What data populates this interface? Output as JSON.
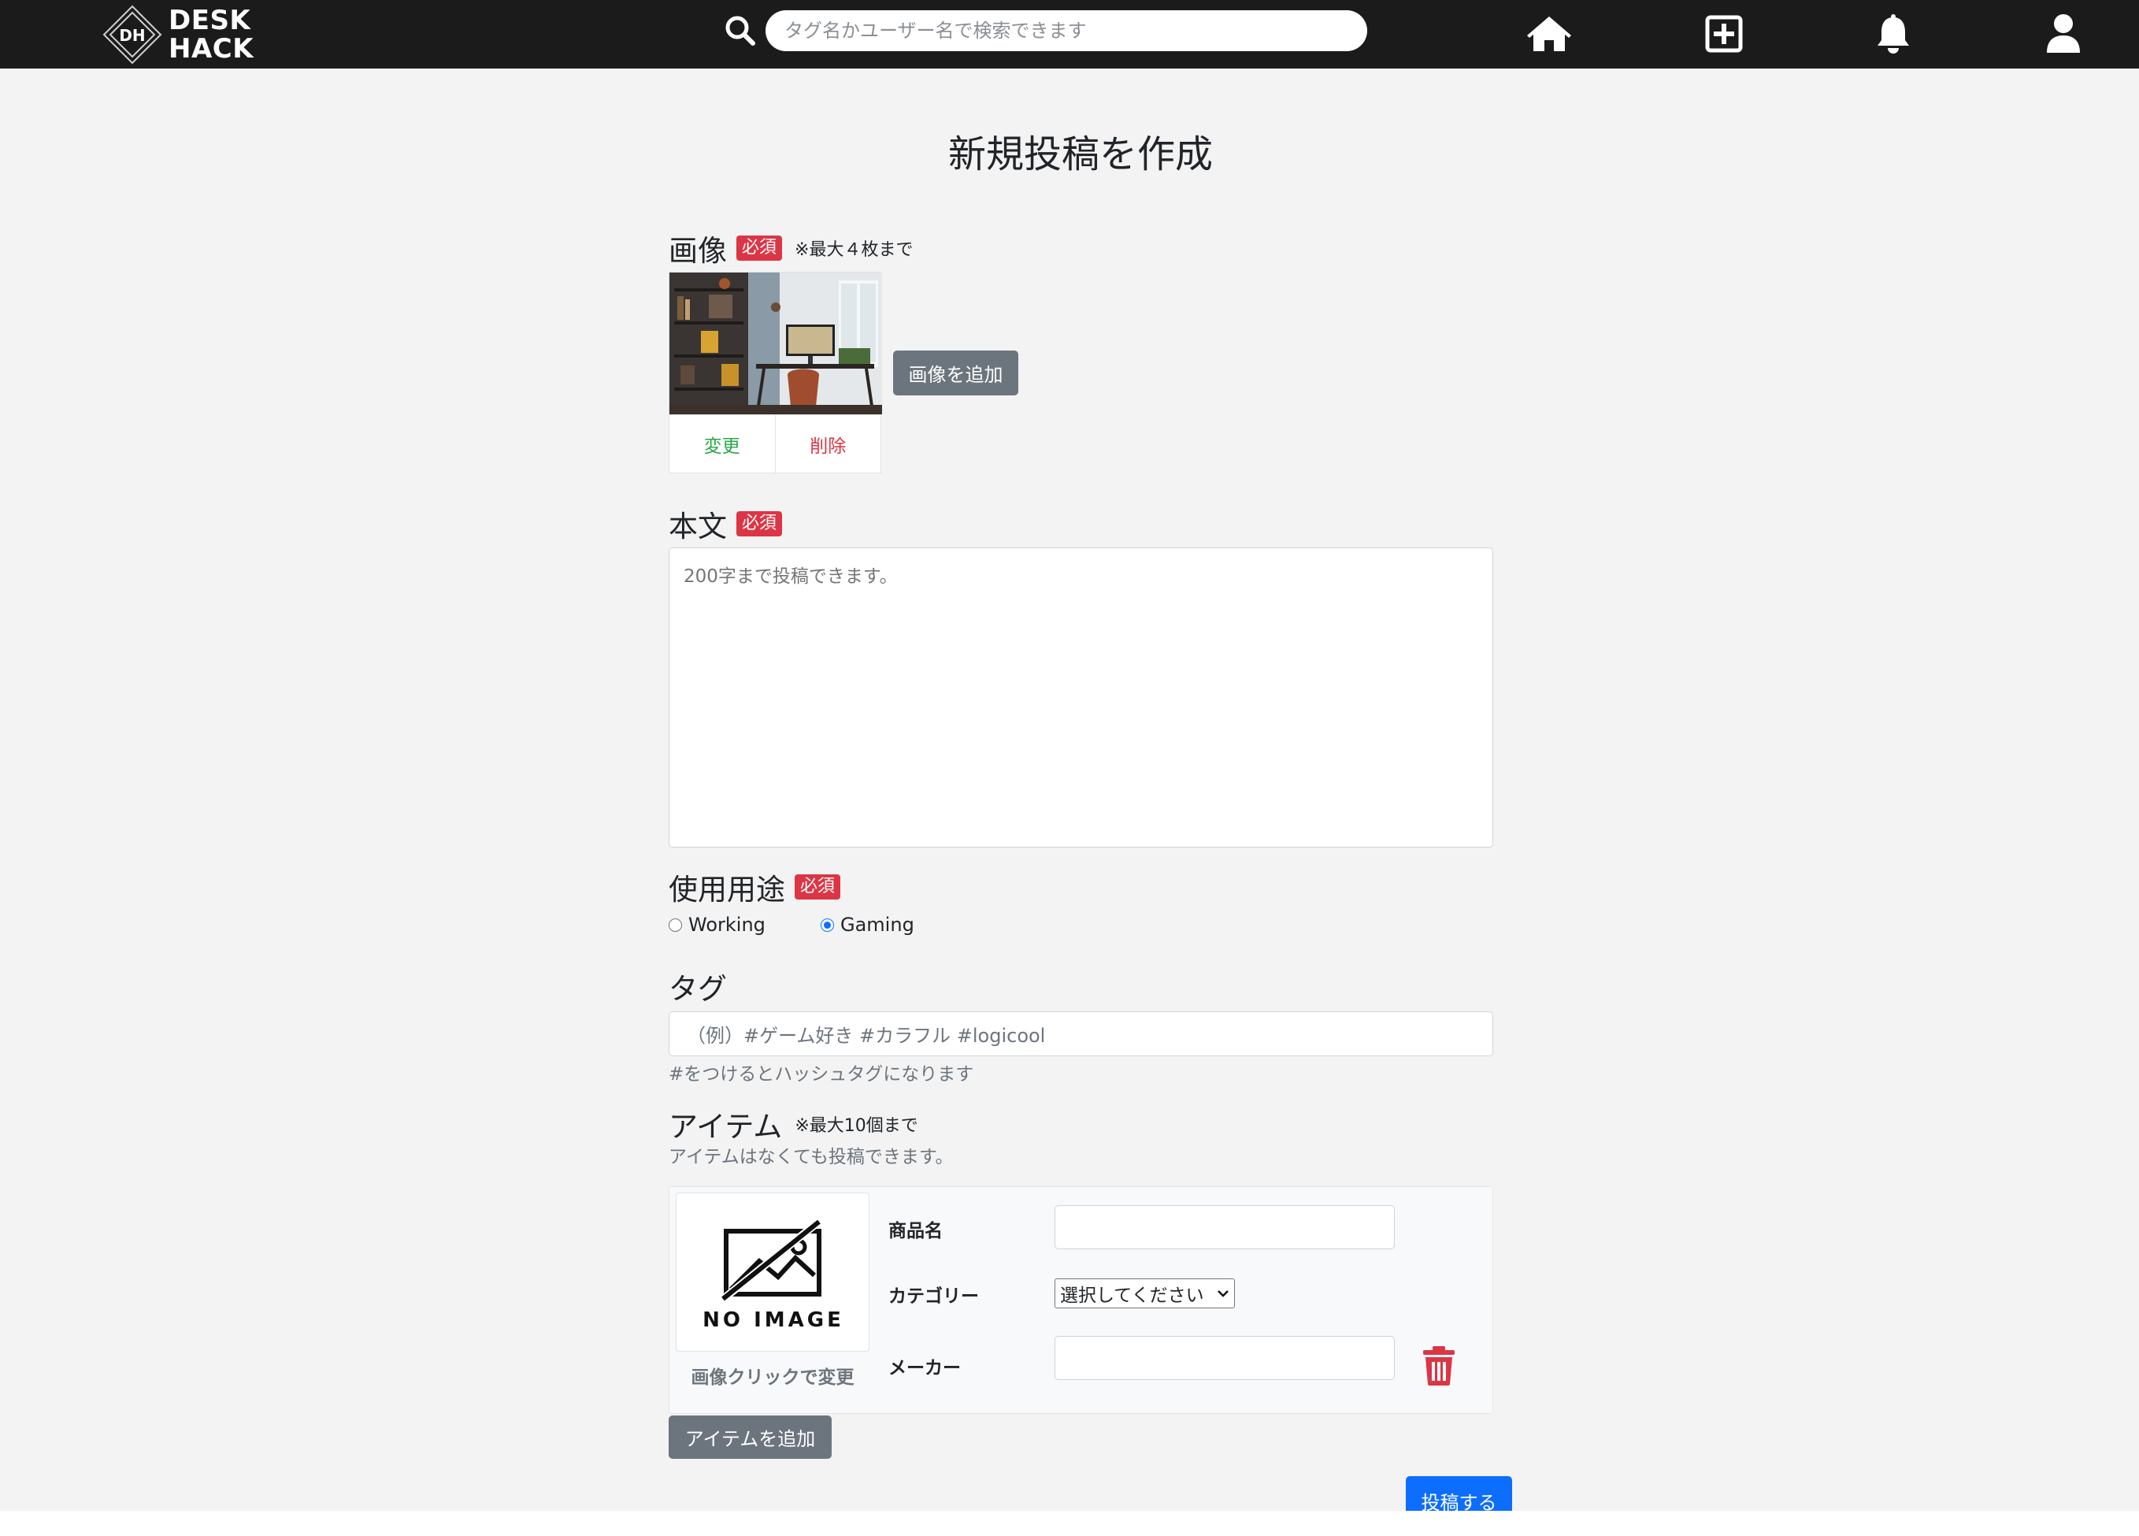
{
  "header": {
    "logo_mark": "DH",
    "logo_line1": "DESK",
    "logo_line2": "HACK",
    "search_placeholder": "タグ名かユーザー名で検索できます",
    "icons": [
      "search-icon",
      "home-icon",
      "plus-square-icon",
      "bell-icon",
      "user-icon"
    ]
  },
  "page": {
    "title": "新規投稿を作成"
  },
  "image_section": {
    "label": "画像",
    "required_badge": "必須",
    "note": "※最大４枚まで",
    "change_label": "変更",
    "delete_label": "削除",
    "add_button": "画像を追加"
  },
  "body_section": {
    "label": "本文",
    "required_badge": "必須",
    "placeholder": "200字まで投稿できます。"
  },
  "usage_section": {
    "label": "使用用途",
    "required_badge": "必須",
    "options": [
      {
        "label": "Working",
        "checked": false
      },
      {
        "label": "Gaming",
        "checked": true
      }
    ]
  },
  "tag_section": {
    "label": "タグ",
    "placeholder": "（例）#ゲーム好き #カラフル #logicool",
    "help": "#をつけるとハッシュタグになります"
  },
  "item_section": {
    "label": "アイテム",
    "note": "※最大10個まで",
    "help": "アイテムはなくても投稿できます。",
    "no_image_text": "NO IMAGE",
    "image_caption": "画像クリックで変更",
    "product_name_label": "商品名",
    "category_label": "カテゴリー",
    "category_selected": "選択してください",
    "maker_label": "メーカー",
    "add_button": "アイテムを追加"
  },
  "submit_button": "投稿する",
  "colors": {
    "navbar": "#1b1b1b",
    "required": "#dc3545",
    "primary": "#0d6efd",
    "secondary": "#6c757d",
    "change": "#28a745"
  }
}
